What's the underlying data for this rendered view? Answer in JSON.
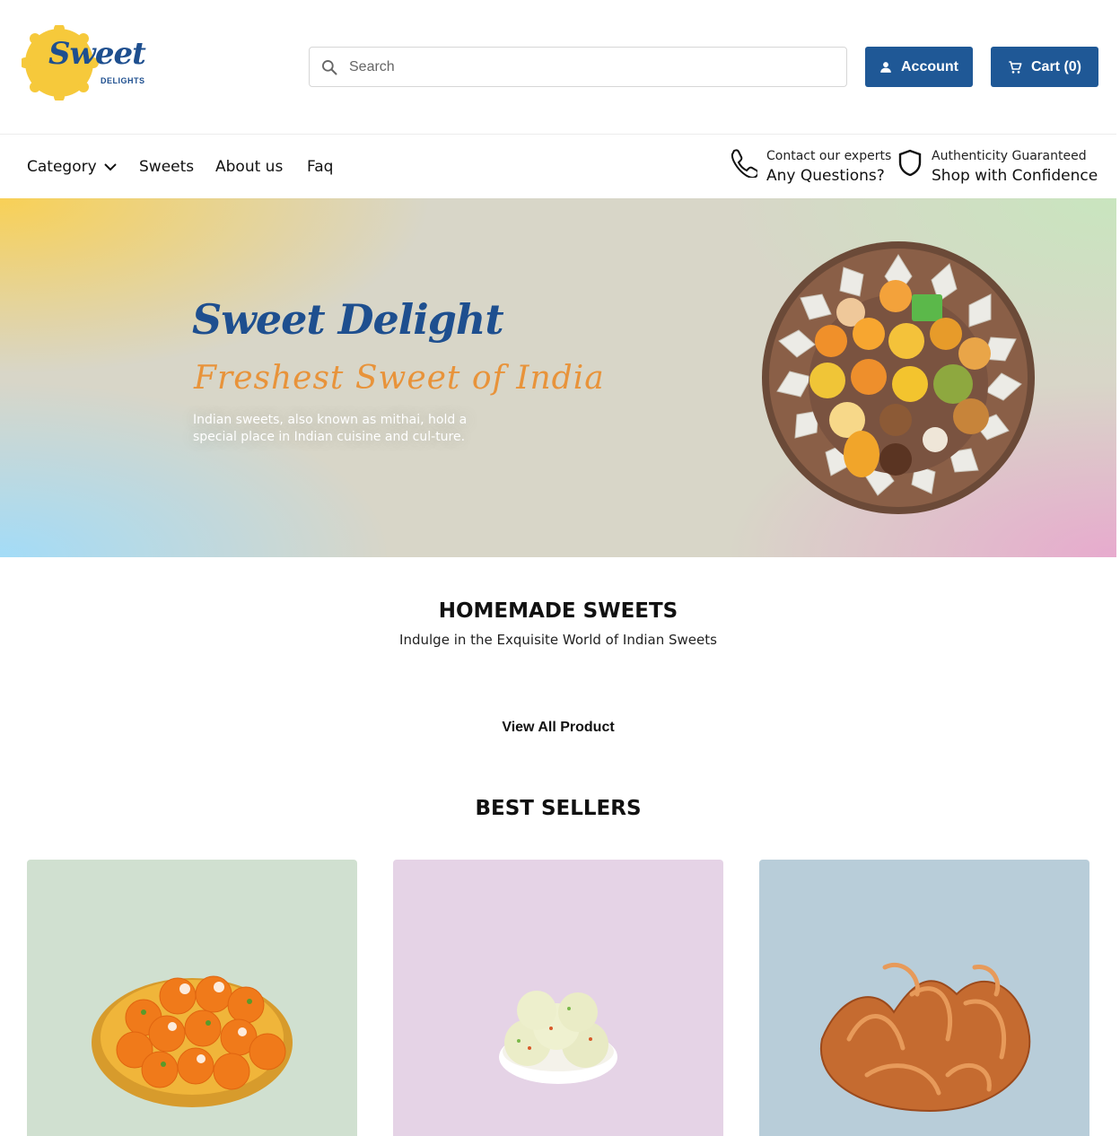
{
  "brand": {
    "logo_main": "Sweet",
    "logo_sub": "DELIGHTS",
    "accent": "#1f5896",
    "logo_yellow": "#f6c93b"
  },
  "search": {
    "placeholder": "Search",
    "value": ""
  },
  "header": {
    "account_label": "Account",
    "cart_label": "Cart (0)"
  },
  "nav": {
    "items": [
      {
        "label": "Category"
      },
      {
        "label": "Sweets"
      },
      {
        "label": "About us"
      },
      {
        "label": "Faq"
      }
    ],
    "contact": {
      "line1": "Contact our experts",
      "line2": "Any Questions?"
    },
    "trust": {
      "line1": "Authenticity Guaranteed",
      "line2": "Shop with Confidence"
    }
  },
  "hero": {
    "title": "Sweet Delight",
    "subtitle": "Freshest Sweet of India",
    "text": "Indian sweets, also known as mithai, hold a special place in Indian cuisine and cul-ture."
  },
  "homemade": {
    "title": "HOMEMADE SWEETS",
    "subtitle": "Indulge in the Exquisite World of Indian Sweets"
  },
  "view_all_label": "View All Product",
  "best_sellers": {
    "title": "BEST SELLERS",
    "cards": [
      {
        "bg": "#d0e0d0",
        "image": "ladoo-plate"
      },
      {
        "bg": "#e5d3e6",
        "image": "rasgulla-bowl"
      },
      {
        "bg": "#b8cdd9",
        "image": "jalebi-pile"
      }
    ]
  }
}
